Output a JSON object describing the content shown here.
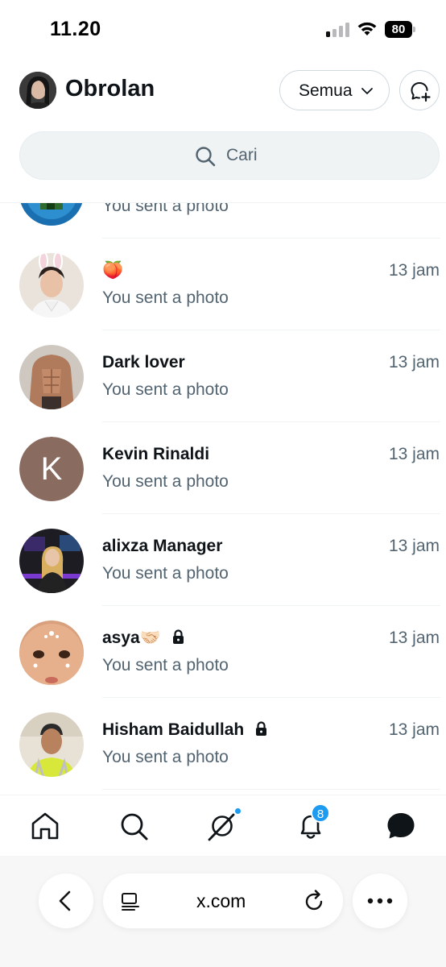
{
  "status_bar": {
    "time": "11.20",
    "battery": "80"
  },
  "header": {
    "title": "Obrolan",
    "filter_label": "Semua",
    "icons": {
      "compose": "new-message-icon",
      "filter_chevron": "chevron-down-icon"
    }
  },
  "search": {
    "placeholder": "Cari",
    "icon": "search-icon"
  },
  "conversations": [
    {
      "name": "",
      "preview": "You sent a photo",
      "time": ""
    },
    {
      "name": "🍑",
      "preview": "You sent a photo",
      "time": "13 jam"
    },
    {
      "name": "Dark lover",
      "preview": "You sent a photo",
      "time": "13 jam"
    },
    {
      "name": "Kevin Rinaldi",
      "avatar_letter": "K",
      "preview": "You sent a photo",
      "time": "13 jam"
    },
    {
      "name": "alixza Manager",
      "preview": "You sent a photo",
      "time": "13 jam"
    },
    {
      "name": "asya🤝🏻",
      "locked": true,
      "preview": "You sent a photo",
      "time": "13 jam"
    },
    {
      "name": "Hisham Baidullah",
      "locked": true,
      "preview": "You sent a photo",
      "time": "13 jam"
    }
  ],
  "bottom_nav": {
    "items": [
      "home-icon",
      "search-icon",
      "grok-icon",
      "notifications-icon",
      "messages-icon"
    ],
    "notification_badge": "8"
  },
  "browser": {
    "url": "x.com",
    "icons": [
      "back-icon",
      "reader-icon",
      "reload-icon",
      "more-icon"
    ]
  },
  "colors": {
    "accent": "#1d9bf0",
    "text_primary": "#0f1419",
    "text_secondary": "#536471",
    "search_bg": "#eff3f4",
    "letter_avatar_bg": "#8a6b60"
  }
}
